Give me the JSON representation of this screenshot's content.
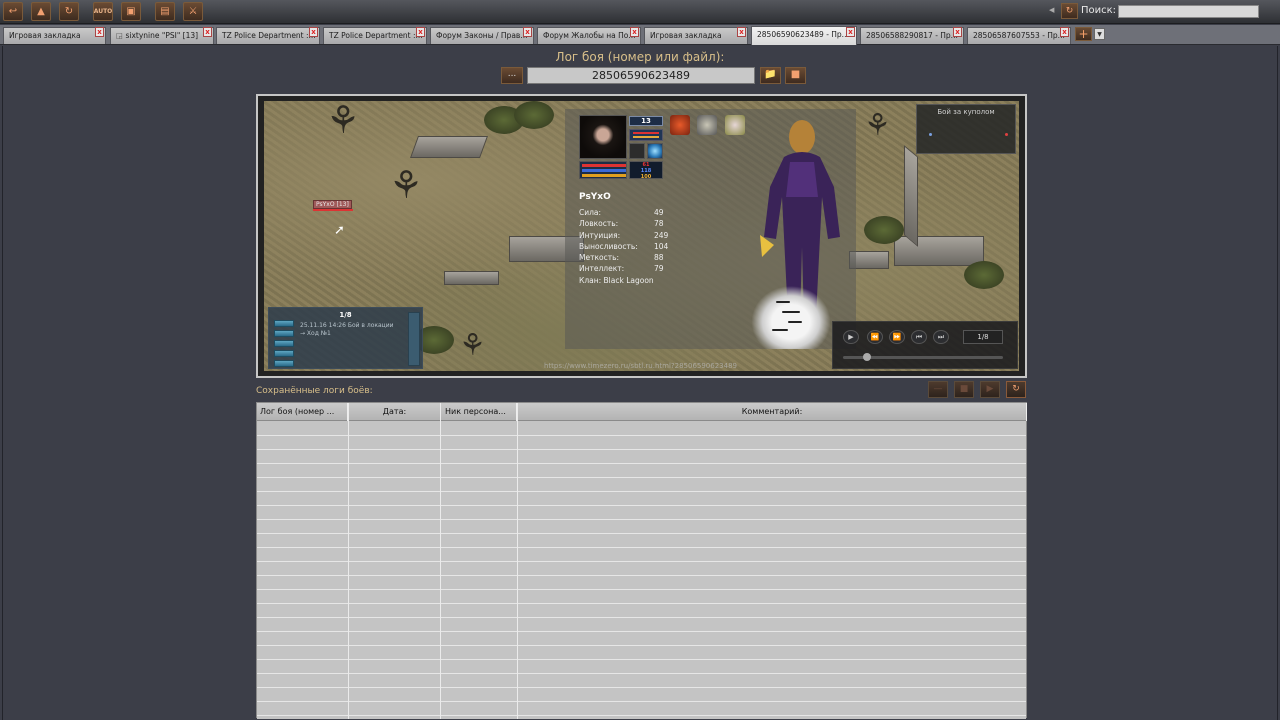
{
  "toolbar": {
    "buttons": [
      {
        "name": "back-icon",
        "glyph": "←"
      },
      {
        "name": "home-icon",
        "glyph": "⌂"
      },
      {
        "name": "refresh-icon",
        "glyph": "↻"
      },
      {
        "name": "auto-icon",
        "glyph": "AUTO"
      },
      {
        "name": "window-icon",
        "glyph": "▣"
      },
      {
        "name": "list-icon",
        "glyph": "≡"
      },
      {
        "name": "game-icon",
        "glyph": "⚔"
      }
    ],
    "search_label": "Поиск:",
    "search_value": ""
  },
  "tabs": [
    {
      "label": "Игровая закладка",
      "active": false
    },
    {
      "label": "sixtynine \"PSI\" [13]",
      "active": false
    },
    {
      "label": "TZ Police Department :...",
      "active": false
    },
    {
      "label": "TZ Police Department :...",
      "active": false
    },
    {
      "label": "Форум Законы / Прав...",
      "active": false
    },
    {
      "label": "Форум Жалобы на По...",
      "active": false
    },
    {
      "label": "Игровая закладка",
      "active": false
    },
    {
      "label": "28506590623489 - Пр...",
      "active": true
    },
    {
      "label": "28506588290817 - Пр...",
      "active": false
    },
    {
      "label": "28506587607553 - Пр...",
      "active": false
    }
  ],
  "log": {
    "title": "Лог боя (номер или файл):",
    "browse_label": "...",
    "value": "28506590623489"
  },
  "game": {
    "player_label": "PsYxO [13]",
    "minimap_title": "Бой за куполом",
    "char_name": "PsYxO",
    "level": "13",
    "hp_values": [
      "61",
      "118",
      "100"
    ],
    "stats": [
      {
        "label": "Сила:",
        "value": "49"
      },
      {
        "label": "Ловкость:",
        "value": "78"
      },
      {
        "label": "Интуиция:",
        "value": "249"
      },
      {
        "label": "Выносливость:",
        "value": "104"
      },
      {
        "label": "Меткость:",
        "value": "88"
      },
      {
        "label": "Интеллект:",
        "value": "79"
      }
    ],
    "clan": "Клан: Black Lagoon",
    "chat_pages": "1/8",
    "chat_text": "25.11.16 14:26 Бой в локации\n→ Ход №1",
    "replay_page": "1/8",
    "url": "https://www.timezero.ru/sbtl.ru.html?28506590623489"
  },
  "saved": {
    "label": "Сохранённые логи боёв:",
    "columns": [
      "Лог боя (номер ...",
      "Дата:",
      "Ник персона...",
      "Комментарий:"
    ],
    "rows": []
  },
  "colors": {
    "accent": "#d8bf8a",
    "tab_close": "#dd2222"
  }
}
